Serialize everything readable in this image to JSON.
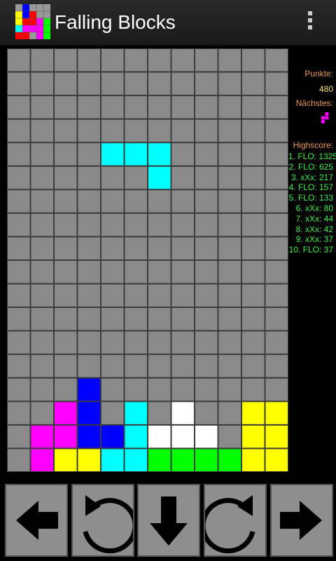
{
  "app": {
    "title": "Falling Blocks",
    "icon": "app-logo-icon"
  },
  "menu": {
    "icon": "overflow-menu-icon"
  },
  "board": {
    "columns": 12,
    "rows": 18,
    "empty_color": "#8a8a8a",
    "grid_color": "#3c3c3c",
    "colors": {
      "C": "#00ffff",
      "B": "#0000ff",
      "M": "#ff00ff",
      "Y": "#ffff00",
      "W": "#ffffff",
      "G": "#00ff00"
    },
    "active_piece": [
      "4,4,C",
      "5,4,C",
      "6,4,C",
      "6,5,C"
    ],
    "settled": [
      "3,14,B",
      "2,15,M",
      "3,15,B",
      "5,15,C",
      "7,15,W",
      "10,15,Y",
      "11,15,Y",
      "1,16,M",
      "2,16,M",
      "3,16,B",
      "4,16,B",
      "5,16,C",
      "6,16,W",
      "7,16,W",
      "8,16,W",
      "10,16,Y",
      "11,16,Y",
      "1,17,M",
      "2,17,Y",
      "3,17,Y",
      "4,17,C",
      "5,17,C",
      "6,17,G",
      "7,17,G",
      "8,17,G",
      "9,17,G",
      "10,17,Y",
      "11,17,Y"
    ]
  },
  "sidebar": {
    "score_label": "Punkte:",
    "score_value": "480",
    "next_label": "Nächstes:",
    "next_piece": {
      "color": "#ff00ff",
      "cells": [
        "1,0",
        "0,1",
        "1,1",
        "0,2"
      ]
    },
    "highscore_label": "Highscore:",
    "highscores": [
      "1. FLO: 1325",
      "2. FLO: 625",
      "3. xXx: 217",
      "4. FLO: 157",
      "5. FLO: 133",
      "6. xXx: 80",
      "7. xXx: 44",
      "8. xXx: 42",
      "9. xXx: 37",
      "10. FLO: 37"
    ]
  },
  "controls": [
    {
      "name": "move-left-button",
      "icon": "arrow-left-icon"
    },
    {
      "name": "rotate-left-button",
      "icon": "rotate-counterclockwise-icon"
    },
    {
      "name": "drop-button",
      "icon": "arrow-down-icon"
    },
    {
      "name": "rotate-right-button",
      "icon": "rotate-clockwise-icon"
    },
    {
      "name": "move-right-button",
      "icon": "arrow-right-icon"
    }
  ]
}
